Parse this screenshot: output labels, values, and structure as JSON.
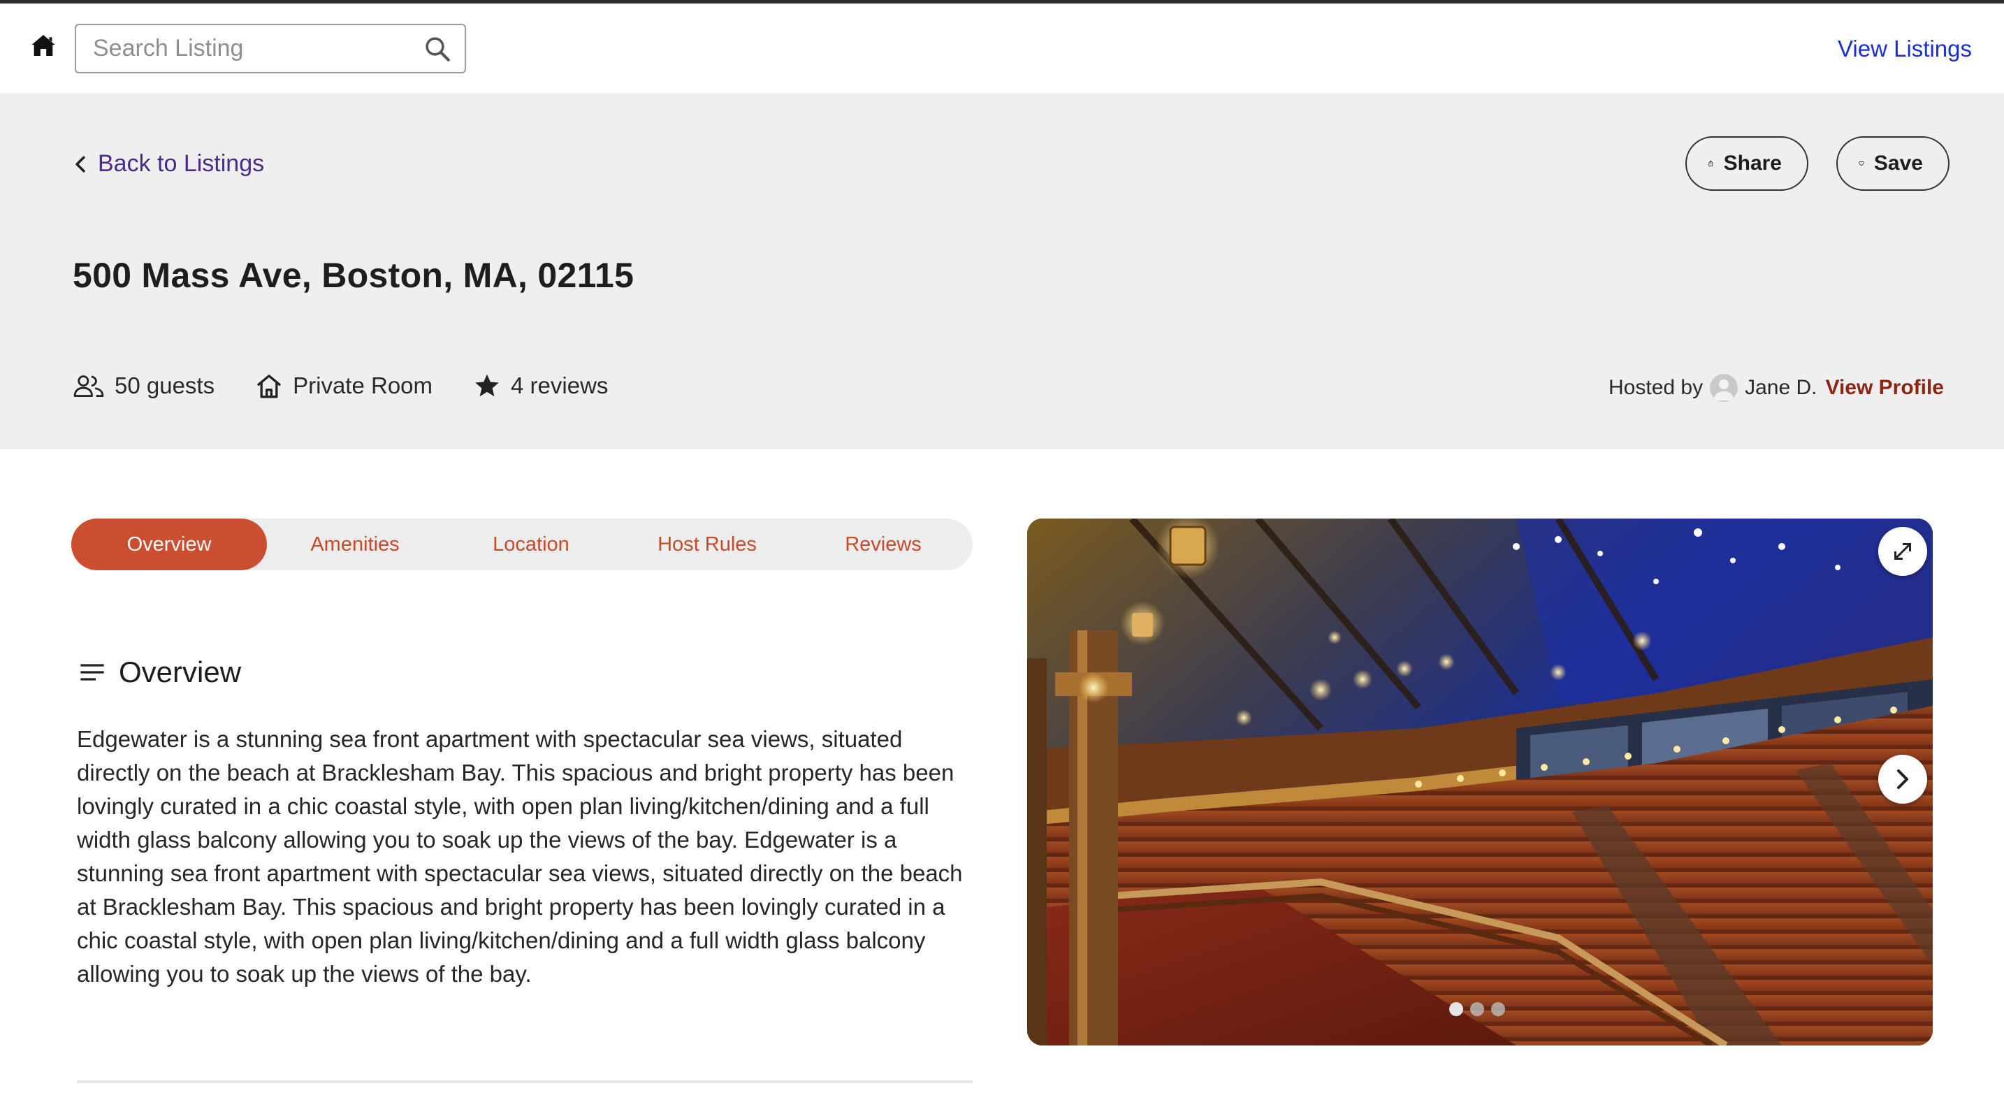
{
  "navbar": {
    "search_placeholder": "Search Listing",
    "view_listings": "View Listings"
  },
  "hero": {
    "back_label": "Back to Listings",
    "share_label": "Share",
    "save_label": "Save",
    "address": "500 Mass Ave, Boston, MA, 02115",
    "guests": "50 guests",
    "room_type": "Private Room",
    "reviews": "4 reviews",
    "hosted_by": "Hosted by",
    "host_name": "Jane D.",
    "view_profile": "View Profile"
  },
  "tabs": [
    {
      "label": "Overview",
      "active": true
    },
    {
      "label": "Amenities",
      "active": false
    },
    {
      "label": "Location",
      "active": false
    },
    {
      "label": "Host Rules",
      "active": false
    },
    {
      "label": "Reviews",
      "active": false
    }
  ],
  "overview": {
    "heading": "Overview",
    "body": "Edgewater is a stunning sea front apartment with spectacular sea views, situated directly on the beach at Bracklesham Bay. This spacious and bright property has been lovingly curated in a chic coastal style, with open plan living/kitchen/dining and a full width glass balcony allowing you to soak up the views of the bay. Edgewater is a stunning sea front apartment with spectacular sea views, situated directly on the beach at Bracklesham Bay. This spacious and bright property has been lovingly curated in a chic coastal style, with open plan living/kitchen/dining and a full width glass balcony allowing you to soak up the views of the bay."
  },
  "gallery": {
    "image_count": 3,
    "active_index": 0
  },
  "colors": {
    "accent": "#cc4e30",
    "tab_text": "#c84a2c",
    "link_blue": "#1a2fd6",
    "back_link": "#4a2a8c",
    "profile_link": "#8b2510",
    "hero_bg": "#efefef"
  },
  "icons": {
    "home": "home-icon",
    "search": "search-icon",
    "back": "chevron-left-icon",
    "share": "share-icon",
    "save": "heart-icon",
    "guests": "users-icon",
    "room": "house-icon",
    "reviews": "star-icon",
    "avatar": "user-avatar-icon",
    "overview": "lines-icon",
    "expand": "expand-icon",
    "next": "chevron-right-icon"
  }
}
